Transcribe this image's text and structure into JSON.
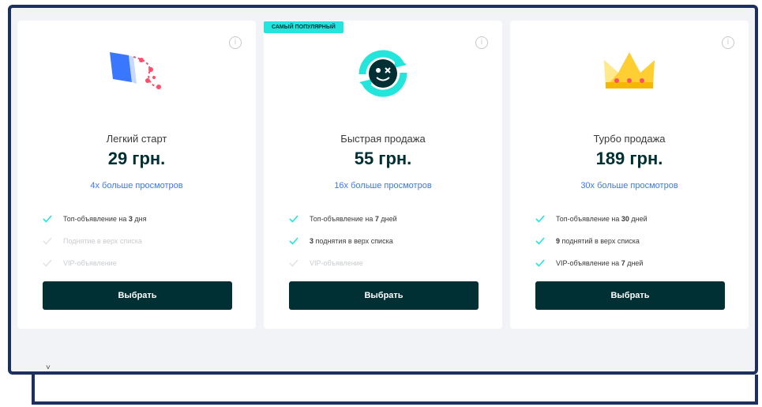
{
  "badge": "САМЫЙ ПОПУЛЯРНЫЙ",
  "cards": [
    {
      "name": "Легкий старт",
      "price": "29 грн.",
      "views": "4х больше просмотров",
      "features": [
        {
          "pre": "Топ-объявление на ",
          "bold": "3",
          "post": " дня",
          "on": true
        },
        {
          "pre": "Поднятие в верх списка",
          "bold": "",
          "post": "",
          "on": false
        },
        {
          "pre": "VIP-объявление",
          "bold": "",
          "post": "",
          "on": false
        }
      ],
      "button": "Выбрать"
    },
    {
      "name": "Быстрая продажа",
      "price": "55 грн.",
      "views": "16х больше просмотров",
      "features": [
        {
          "pre": "Топ-объявление на ",
          "bold": "7",
          "post": " дней",
          "on": true
        },
        {
          "pre": "",
          "bold": "3",
          "post": " поднятия в верх списка",
          "on": true
        },
        {
          "pre": "VIP-объявление",
          "bold": "",
          "post": "",
          "on": false
        }
      ],
      "button": "Выбрать"
    },
    {
      "name": "Турбо продажа",
      "price": "189 грн.",
      "views": "30х больше просмотров",
      "features": [
        {
          "pre": "Топ-объявление на ",
          "bold": "30",
          "post": " дней",
          "on": true
        },
        {
          "pre": "",
          "bold": "9",
          "post": " поднятий в верх списка",
          "on": true
        },
        {
          "pre": "VIP-объявление на ",
          "bold": "7",
          "post": " дней",
          "on": true
        }
      ],
      "button": "Выбрать"
    }
  ],
  "colors": {
    "accent": "#3a77ff",
    "dark": "#002f34",
    "check": "#23e5db",
    "badge": "#23e5db",
    "frame": "#1c2f5e"
  },
  "icons": [
    "info-icon",
    "arrow-trail-icon",
    "smiley-refresh-icon",
    "crown-icon",
    "check-icon",
    "chevron-down-icon"
  ]
}
